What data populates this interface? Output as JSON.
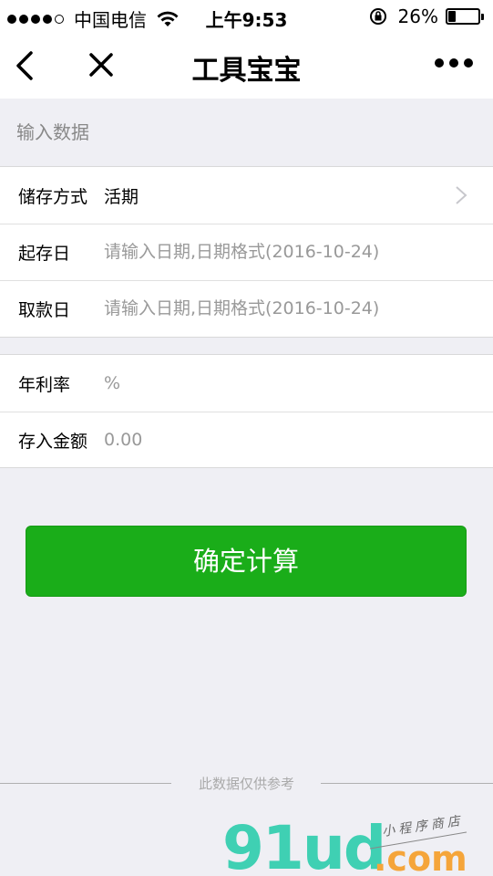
{
  "status_bar": {
    "carrier": "中国电信",
    "time": "上午9:53",
    "battery": "26%",
    "battery_level": 0.26
  },
  "nav": {
    "title": "工具宝宝"
  },
  "section_header": "输入数据",
  "group1": [
    {
      "label": "储存方式",
      "value": "活期"
    },
    {
      "label": "起存日",
      "placeholder": "请输入日期,日期格式(2016-10-24)"
    },
    {
      "label": "取款日",
      "placeholder": "请输入日期,日期格式(2016-10-24)"
    }
  ],
  "group2": [
    {
      "label": "年利率",
      "placeholder": "%"
    },
    {
      "label": "存入金额",
      "placeholder": "0.00"
    }
  ],
  "confirm_label": "确定计算",
  "footer_text": "此数据仅供参考",
  "watermark": {
    "logo_text": "91ud",
    "suffix": ".com",
    "tagline": "小程序商店"
  },
  "colors": {
    "accent": "#1aad19",
    "background": "#efeff4"
  }
}
